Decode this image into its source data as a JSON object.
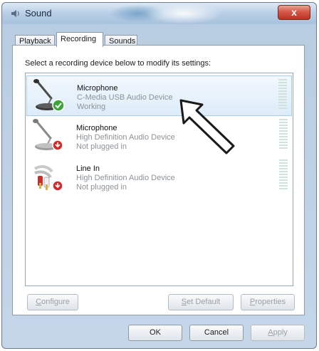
{
  "window": {
    "title": "Sound",
    "close_label": "x"
  },
  "tabs": [
    {
      "label": "Playback",
      "active": false
    },
    {
      "label": "Recording",
      "active": true
    },
    {
      "label": "Sounds",
      "active": false
    }
  ],
  "instruction": "Select a recording device below to modify its settings:",
  "devices": [
    {
      "name": "Microphone",
      "description": "C-Media USB Audio Device",
      "status": "Working",
      "icon": "microphone-icon",
      "badge": "check-badge-icon",
      "selected": true
    },
    {
      "name": "Microphone",
      "description": "High Definition Audio Device",
      "status": "Not plugged in",
      "icon": "microphone-icon",
      "badge": "unplugged-badge-icon",
      "selected": false
    },
    {
      "name": "Line In",
      "description": "High Definition Audio Device",
      "status": "Not plugged in",
      "icon": "line-in-cable-icon",
      "badge": "unplugged-badge-icon",
      "selected": false
    }
  ],
  "buttons": {
    "configure": {
      "pre": "",
      "accel": "C",
      "post": "onfigure",
      "enabled": false
    },
    "set_default": {
      "pre": "",
      "accel": "S",
      "post": "et Default",
      "enabled": false
    },
    "properties": {
      "pre": "",
      "accel": "P",
      "post": "roperties",
      "enabled": false
    },
    "ok": {
      "label": "OK",
      "enabled": true
    },
    "cancel": {
      "label": "Cancel",
      "enabled": true
    },
    "apply": {
      "pre": "",
      "accel": "A",
      "post": "pply",
      "enabled": false
    }
  },
  "colors": {
    "selection_border": "#a9cde9",
    "close_button": "#c8412e",
    "badge_green": "#3ea33b",
    "badge_red": "#d12a2a"
  }
}
